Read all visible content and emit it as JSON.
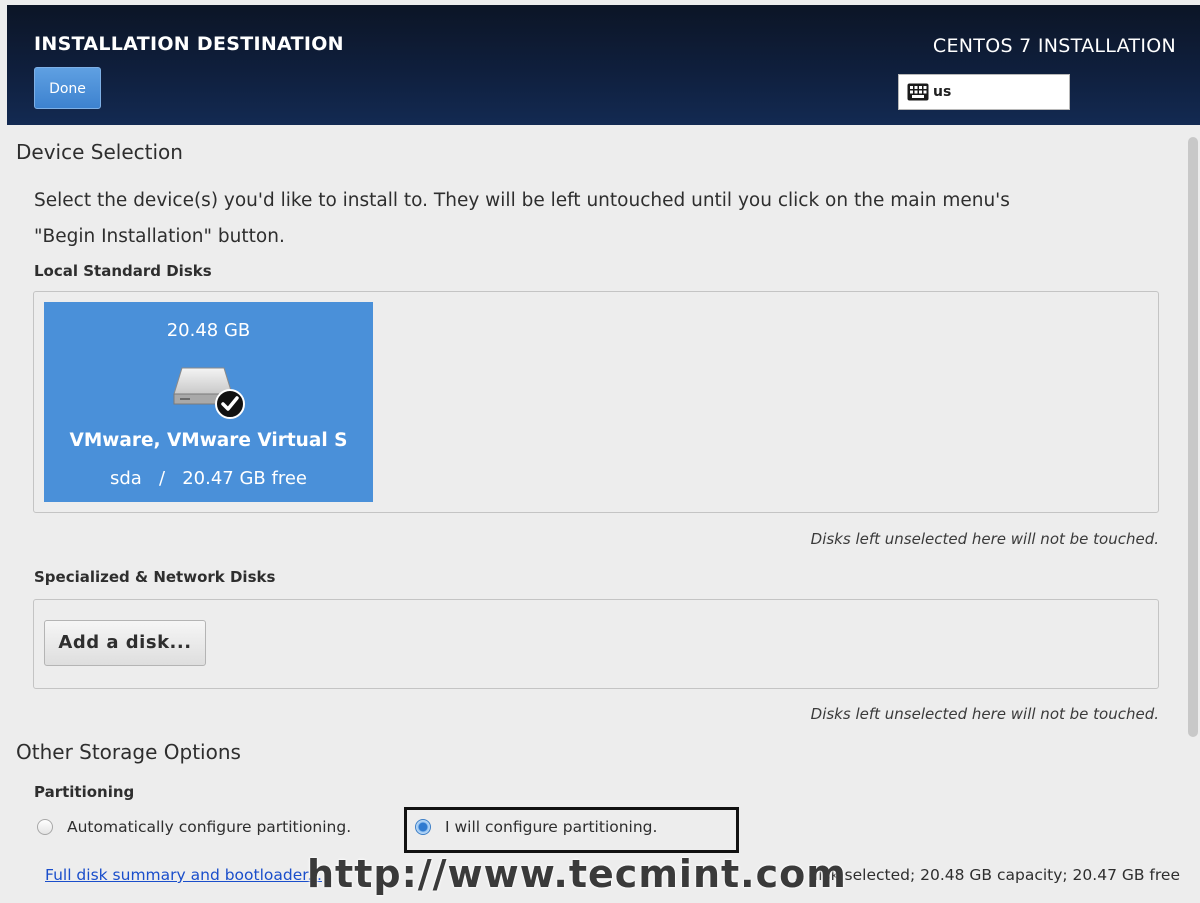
{
  "header": {
    "title": "INSTALLATION DESTINATION",
    "done_label": "Done",
    "product": "CENTOS 7 INSTALLATION",
    "keyboard_layout": "us",
    "keyboard_icon": "keyboard-icon"
  },
  "device_selection": {
    "title": "Device Selection",
    "intro_line1": "Select the device(s) you'd like to install to.  They will be left untouched until you click on the main menu's",
    "intro_line2": "\"Begin Installation\" button."
  },
  "local_disks": {
    "label": "Local Standard Disks",
    "disks": [
      {
        "size": "20.48 GB",
        "name": "VMware, VMware Virtual S",
        "free": "sda   /   20.47 GB free",
        "selected": true,
        "icon": "hard-disk-checked-icon"
      }
    ],
    "hint": "Disks left unselected here will not be touched."
  },
  "network_disks": {
    "label": "Specialized & Network Disks",
    "add_button": "Add a disk...",
    "hint": "Disks left unselected here will not be touched."
  },
  "other_storage": {
    "title": "Other Storage Options",
    "partitioning_label": "Partitioning",
    "options": [
      {
        "label": "Automatically configure partitioning.",
        "checked": false
      },
      {
        "label": "I will configure partitioning.",
        "checked": true
      }
    ]
  },
  "footer": {
    "summary_link": "Full disk summary and bootloader...",
    "capacity": "1 disk selected; 20.48 GB capacity; 20.47 GB free",
    "watermark": "http://www.tecmint.com"
  },
  "colors": {
    "header_bg": "#0f1f3d",
    "accent": "#4a90d9",
    "link": "#1a4ecb"
  }
}
